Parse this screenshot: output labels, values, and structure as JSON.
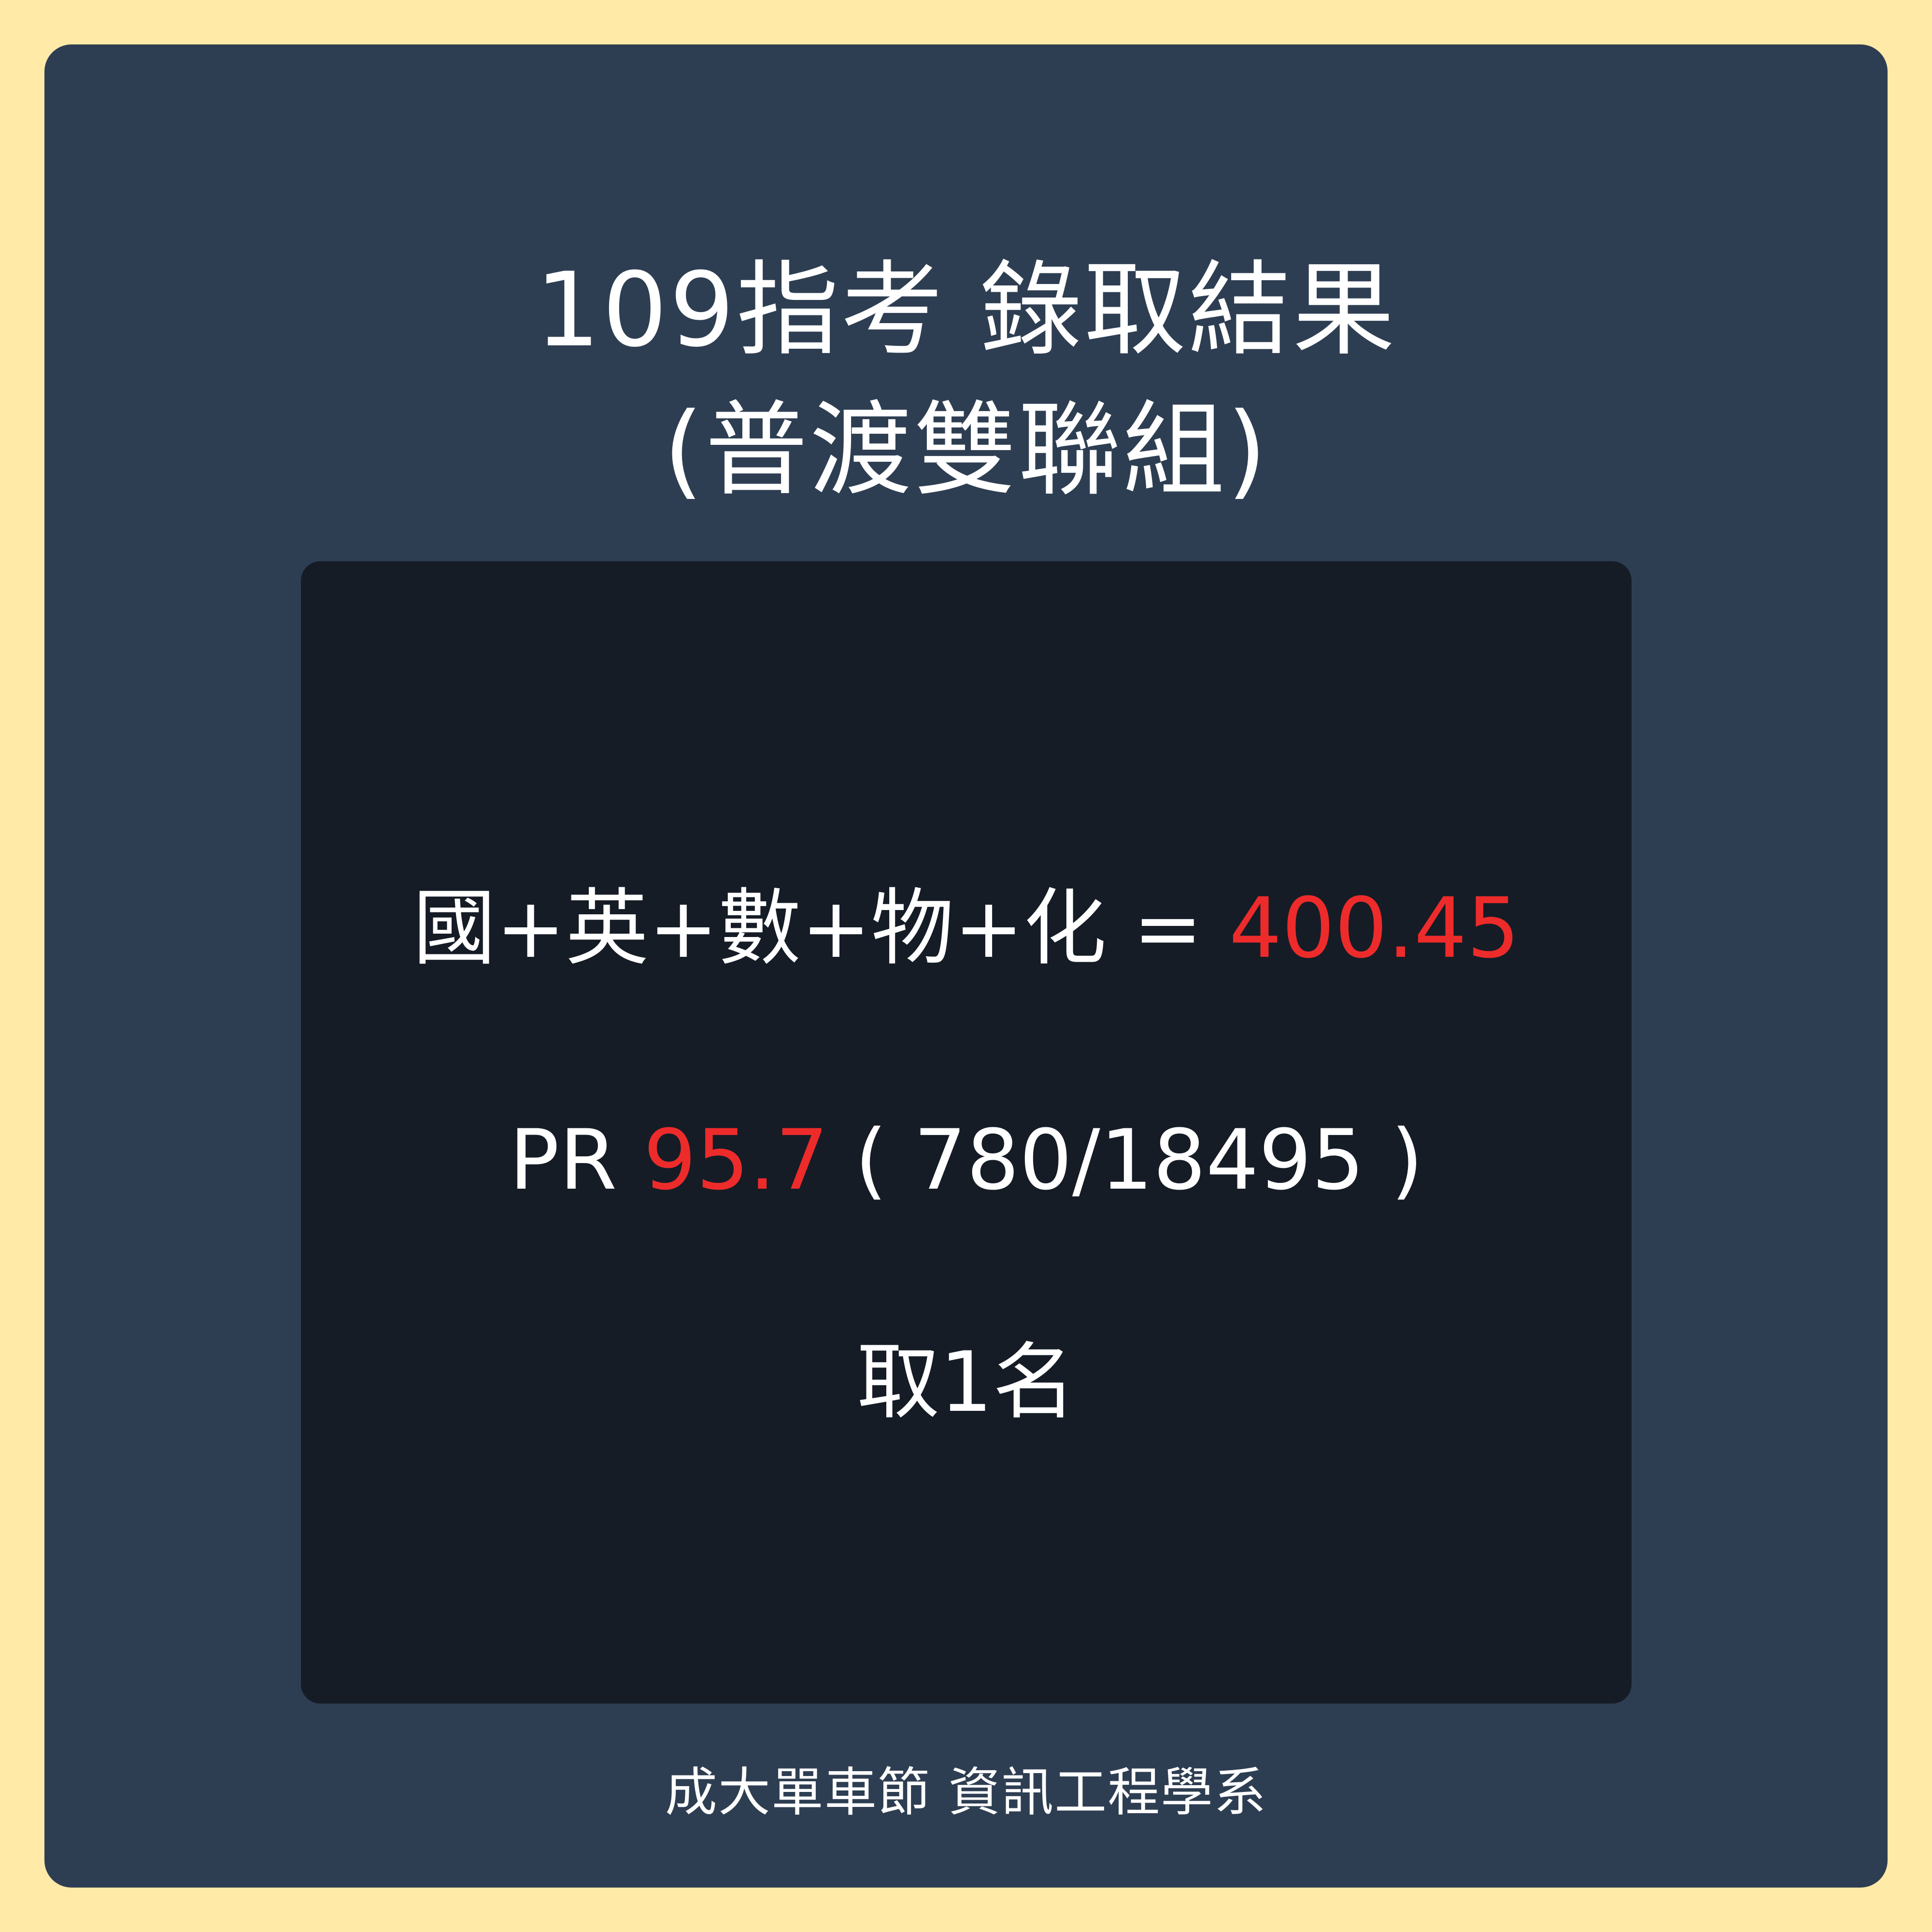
{
  "colors": {
    "page_background": "#ffeaa8",
    "card_background": "#2e3e52",
    "panel_background": "#151c26",
    "text": "#ffffff",
    "highlight": "#ee2b2b"
  },
  "header": {
    "title_line1": "109指考 錄取結果",
    "title_line2": "(普渡雙聯組)"
  },
  "result": {
    "score_label": "國+英+數+物+化 = ",
    "score_value": "400.45",
    "pr_label": "PR ",
    "pr_value": "95.7",
    "rank_text": " ( 780/18495 )",
    "admission": "取1名"
  },
  "footer": {
    "text": "成大單車節 資訊工程學系"
  }
}
